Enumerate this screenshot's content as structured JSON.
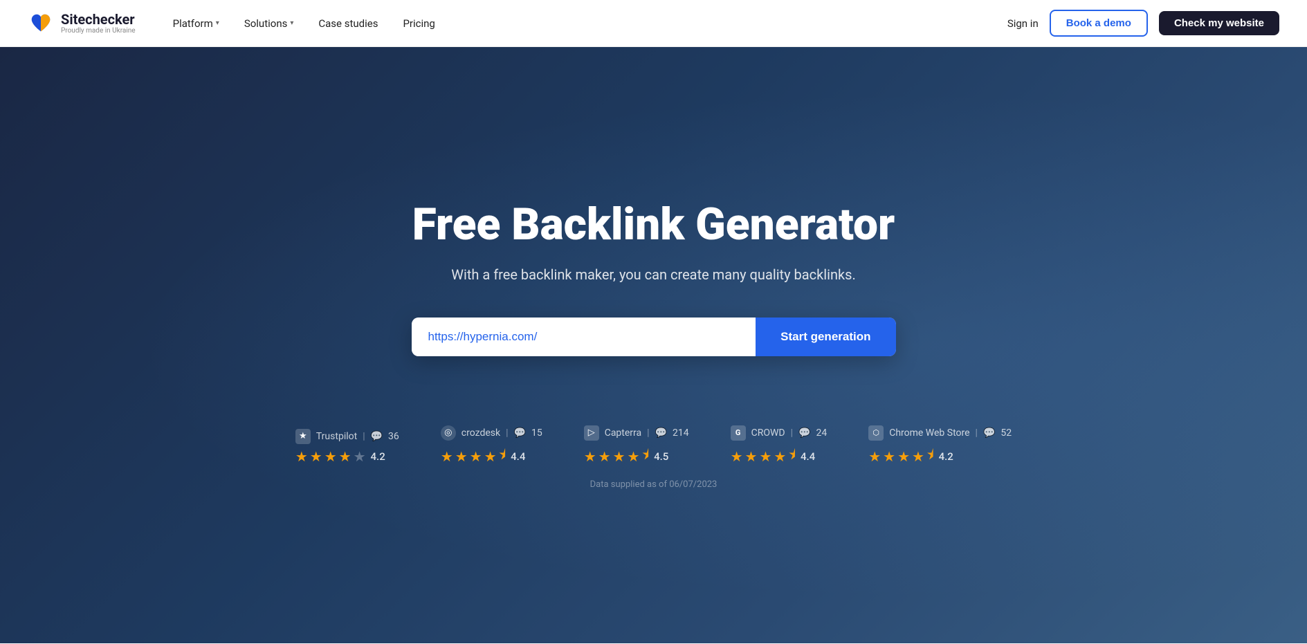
{
  "navbar": {
    "logo_name": "Sitechecker",
    "logo_tagline": "Proudly made in Ukraine",
    "nav_items": [
      {
        "label": "Platform",
        "has_dropdown": true
      },
      {
        "label": "Solutions",
        "has_dropdown": true
      },
      {
        "label": "Case studies",
        "has_dropdown": false
      },
      {
        "label": "Pricing",
        "has_dropdown": false
      }
    ],
    "signin_label": "Sign in",
    "book_demo_label": "Book a demo",
    "check_website_label": "Check my website"
  },
  "hero": {
    "title": "Free Backlink Generator",
    "subtitle": "With a free backlink maker, you can create many quality backlinks.",
    "input_placeholder": "https://hypernia.com/",
    "input_value": "https://hypernia.com/",
    "start_button_label": "Start generation"
  },
  "ratings": [
    {
      "platform": "Trustpilot",
      "icon": "★",
      "reviews": "36",
      "stars_full": 4,
      "stars_half": 0,
      "stars_empty": 1,
      "score": "4.2"
    },
    {
      "platform": "crozdesk",
      "icon": "◎",
      "reviews": "15",
      "stars_full": 4,
      "stars_half": 1,
      "stars_empty": 0,
      "score": "4.4"
    },
    {
      "platform": "Capterra",
      "icon": "▷",
      "reviews": "214",
      "stars_full": 4,
      "stars_half": 1,
      "stars_empty": 0,
      "score": "4.5"
    },
    {
      "platform": "CROWD",
      "icon": "G",
      "reviews": "24",
      "stars_full": 4,
      "stars_half": 1,
      "stars_empty": 0,
      "score": "4.4"
    },
    {
      "platform": "Chrome Web Store",
      "icon": "⬡",
      "reviews": "52",
      "stars_full": 4,
      "stars_half": 1,
      "stars_empty": 0,
      "score": "4.2"
    }
  ],
  "data_note": "Data supplied as of 06/07/2023"
}
